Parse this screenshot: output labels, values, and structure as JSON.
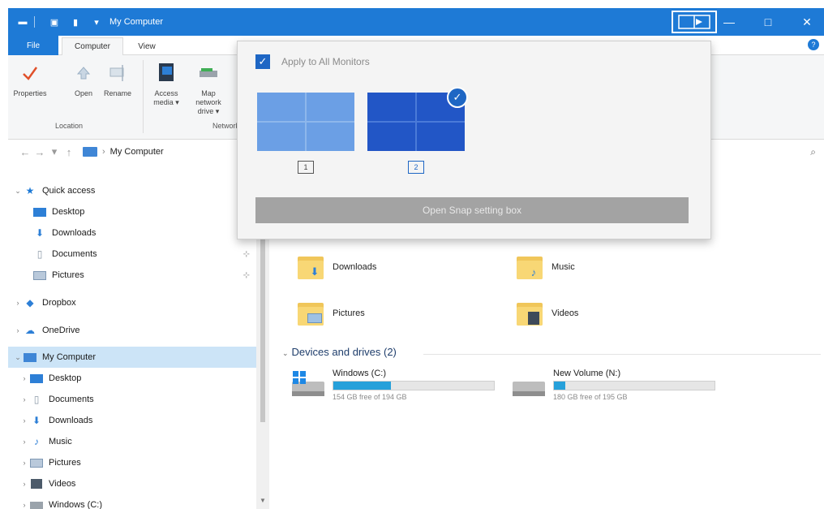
{
  "window": {
    "title": "My Computer",
    "controls": {
      "minimize": "—",
      "maximize": "□",
      "close": "✕"
    }
  },
  "ribbon": {
    "tabs": [
      "File",
      "Computer",
      "View"
    ],
    "active_tab": "Computer",
    "help": "?",
    "buttons": [
      {
        "label": "Properties",
        "icon": "properties-check-icon"
      },
      {
        "label": "Open",
        "icon": "open-icon"
      },
      {
        "label": "Rename",
        "icon": "rename-icon"
      },
      {
        "label": "Access media ▾",
        "icon": "access-media-icon"
      },
      {
        "label": "Map network drive ▾",
        "icon": "map-drive-icon"
      }
    ],
    "groups": [
      "Location",
      "Network"
    ]
  },
  "address": {
    "back": "←",
    "forward": "→",
    "recent": "▾",
    "up": "↑",
    "path": "My Computer",
    "separator": "›",
    "search_icon": "⌕"
  },
  "nav": {
    "quick_access": "Quick access",
    "items": [
      {
        "label": "Desktop",
        "icon": "desktop-icon",
        "pinned": true
      },
      {
        "label": "Downloads",
        "icon": "downloads-icon",
        "pinned": true
      },
      {
        "label": "Documents",
        "icon": "documents-icon",
        "pinned": true
      },
      {
        "label": "Pictures",
        "icon": "pictures-icon",
        "pinned": true
      },
      {
        "label": "Dropbox",
        "icon": "dropbox-icon"
      },
      {
        "label": "OneDrive",
        "icon": "onedrive-icon"
      },
      {
        "label": "My Computer",
        "icon": "computer-icon",
        "selected": true
      },
      {
        "label": "Desktop",
        "icon": "desktop-icon"
      },
      {
        "label": "Documents",
        "icon": "documents-icon"
      },
      {
        "label": "Downloads",
        "icon": "downloads-icon"
      },
      {
        "label": "Music",
        "icon": "music-icon"
      },
      {
        "label": "Pictures",
        "icon": "pictures-icon"
      },
      {
        "label": "Videos",
        "icon": "videos-icon"
      },
      {
        "label": "Windows (C:)",
        "icon": "drive-icon"
      }
    ]
  },
  "content": {
    "folders": [
      {
        "label": "Downloads",
        "icon": "downloads-folder-icon"
      },
      {
        "label": "Music",
        "icon": "music-folder-icon"
      },
      {
        "label": "Pictures",
        "icon": "pictures-folder-icon"
      },
      {
        "label": "Videos",
        "icon": "videos-folder-icon"
      }
    ],
    "section_title": "Devices and drives (2)",
    "drives": [
      {
        "name": "Windows (C:)",
        "free": "154 GB free of 194 GB",
        "used_fraction": 0.36
      },
      {
        "name": "New Volume (N:)",
        "free": "180 GB free of 195 GB",
        "used_fraction": 0.07
      }
    ]
  },
  "popup": {
    "apply_all_label": "Apply to All Monitors",
    "apply_all_checked": true,
    "monitors": [
      {
        "number": "1",
        "selected": false
      },
      {
        "number": "2",
        "selected": true
      }
    ],
    "button_label": "Open Snap setting box"
  },
  "colors": {
    "accent": "#1e7ad6",
    "monitor_light": "#6b9fe5",
    "monitor_dark": "#2256c6",
    "drive_fill": "#26a0da",
    "selection": "#cce4f7"
  }
}
